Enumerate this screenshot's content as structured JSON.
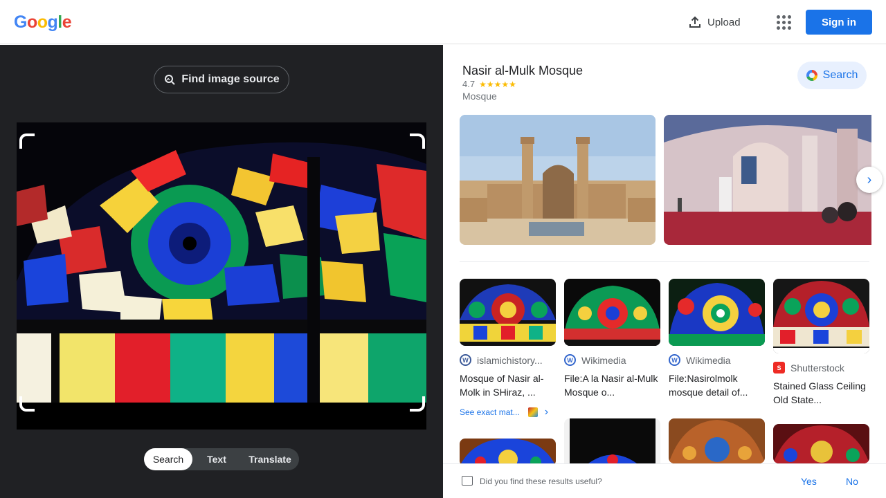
{
  "header": {
    "logo_letters": [
      {
        "ch": "G",
        "color": "#4285f4"
      },
      {
        "ch": "o",
        "color": "#ea4335"
      },
      {
        "ch": "o",
        "color": "#fbbc04"
      },
      {
        "ch": "g",
        "color": "#4285f4"
      },
      {
        "ch": "l",
        "color": "#34a853"
      },
      {
        "ch": "e",
        "color": "#ea4335"
      }
    ],
    "upload_label": "Upload",
    "signin_label": "Sign in"
  },
  "left": {
    "find_source_label": "Find image source",
    "modes": [
      "Search",
      "Text",
      "Translate"
    ],
    "active_mode": "Search"
  },
  "entity": {
    "title": "Nasir al-Mulk Mosque",
    "rating": "4.7",
    "stars": "★★★★★",
    "type": "Mosque",
    "search_label": "Search"
  },
  "results": [
    {
      "source": "islamichistory...",
      "title": "Mosque of Nasir al-Molk in SHiraz, ...",
      "icon": "wordpress-icon",
      "exact_label": "See exact mat..."
    },
    {
      "source": "Wikimedia",
      "title": "File:A la Nasir al-Mulk Mosque o...",
      "icon": "wikimedia-icon"
    },
    {
      "source": "Wikimedia",
      "title": "File:Nasirolmolk mosque detail of...",
      "icon": "wikimedia-icon"
    },
    {
      "source": "Shutterstock",
      "title": "Stained Glass Ceiling Old State...",
      "icon": "shutterstock-icon"
    }
  ],
  "feedback": {
    "question": "Did you find these results useful?",
    "yes": "Yes",
    "no": "No"
  },
  "colors": {
    "accent": "#1a73e8",
    "dark_bg": "#202124",
    "star": "#fbbc04"
  }
}
